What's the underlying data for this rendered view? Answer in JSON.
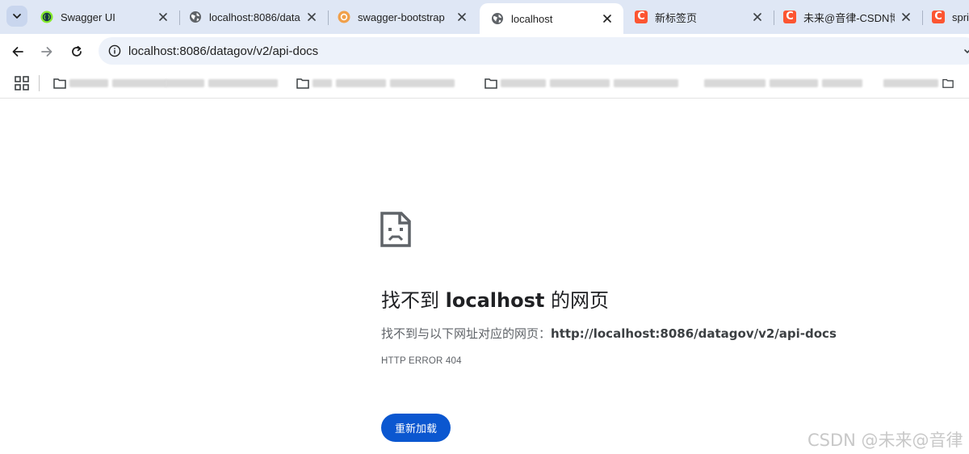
{
  "tabs": [
    {
      "title": "Swagger UI",
      "favicon": "swagger-icon",
      "active": false
    },
    {
      "title": "localhost:8086/data",
      "favicon": "globe-icon",
      "active": false
    },
    {
      "title": "swagger-bootstrap",
      "favicon": "bootstrap-icon",
      "active": false
    },
    {
      "title": "localhost",
      "favicon": "globe-icon",
      "active": true
    },
    {
      "title": "新标签页",
      "favicon": "csdn-icon",
      "active": false
    },
    {
      "title": "未来@音律-CSDN博",
      "favicon": "csdn-icon",
      "active": false
    },
    {
      "title": "spri",
      "favicon": "csdn-icon",
      "active": false
    }
  ],
  "csdn_favicon_letter": "C",
  "address_bar": {
    "url": "localhost:8086/datagov/v2/api-docs"
  },
  "error_page": {
    "title_prefix": "找不到",
    "title_host": "localhost",
    "title_suffix": "的网页",
    "detail_prefix": "找不到与以下网址对应的网页：",
    "detail_url": "http://localhost:8086/datagov/v2/api-docs",
    "error_code": "HTTP ERROR 404",
    "reload_label": "重新加载"
  },
  "watermark": "CSDN @未来@音律",
  "colors": {
    "tabstrip_bg": "#dfe7f5",
    "omnibox_bg": "#edf2fa",
    "primary_button": "#0b57d0",
    "csdn_red": "#fc5531"
  }
}
